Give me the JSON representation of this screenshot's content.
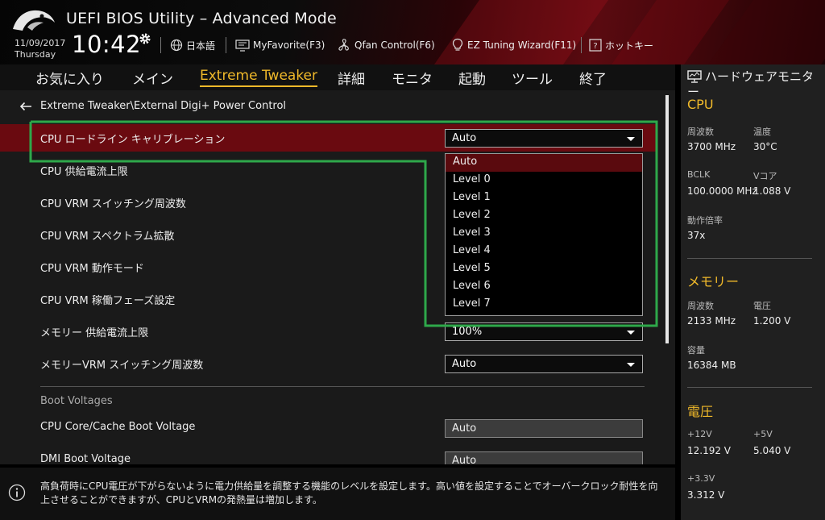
{
  "header": {
    "title": "UEFI BIOS Utility – Advanced Mode",
    "date": "11/09/2017",
    "day": "Thursday",
    "time": "10:42",
    "items": [
      {
        "label": "日本語",
        "icon": "globe-icon"
      },
      {
        "label": "MyFavorite(F3)",
        "icon": "favorite-monitor-icon"
      },
      {
        "label": "Qfan Control(F6)",
        "icon": "fan-icon"
      },
      {
        "label": "EZ Tuning Wizard(F11)",
        "icon": "bulb-icon"
      },
      {
        "label": "ホットキー",
        "icon": "hotkey-icon"
      }
    ]
  },
  "tabs": [
    {
      "label": "お気に入り",
      "active": false
    },
    {
      "label": "メイン",
      "active": false
    },
    {
      "label": "Extreme Tweaker",
      "active": true
    },
    {
      "label": "詳細",
      "active": false
    },
    {
      "label": "モニタ",
      "active": false
    },
    {
      "label": "起動",
      "active": false
    },
    {
      "label": "ツール",
      "active": false
    },
    {
      "label": "終了",
      "active": false
    }
  ],
  "breadcrumb": "Extreme Tweaker\\External Digi+ Power Control",
  "settings": [
    {
      "label": "CPU ロードライン キャリブレーション",
      "value": "Auto"
    },
    {
      "label": "CPU 供給電流上限",
      "value": ""
    },
    {
      "label": "CPU VRM スイッチング周波数",
      "value": ""
    },
    {
      "label": "CPU VRM スペクトラム拡散",
      "value": ""
    },
    {
      "label": "CPU VRM 動作モード",
      "value": ""
    },
    {
      "label": "CPU VRM 稼働フェーズ設定",
      "value": ""
    },
    {
      "label": "メモリー 供給電流上限",
      "value": "100%"
    },
    {
      "label": "メモリーVRM スイッチング周波数",
      "value": "Auto"
    }
  ],
  "boot_section": {
    "title": "Boot Voltages",
    "items": [
      {
        "label": "CPU Core/Cache Boot Voltage",
        "value": "Auto"
      },
      {
        "label": "DMI Boot Voltage",
        "value": "Auto"
      }
    ]
  },
  "dropdown": {
    "options": [
      "Auto",
      "Level 0",
      "Level 1",
      "Level 2",
      "Level 3",
      "Level 4",
      "Level 5",
      "Level 6",
      "Level 7"
    ],
    "highlighted": "Auto"
  },
  "help_text": "高負荷時にCPU電圧が下がらないように電力供給量を調整する機能のレベルを設定します。高い値を設定することでオーバークロック耐性を向上させることができますが、CPUとVRMの発熱量は増加します。",
  "hw_monitor": {
    "title": "ハードウェアモニター",
    "cpu": {
      "title": "CPU",
      "freq_label": "周波数",
      "freq": "3700 MHz",
      "temp_label": "温度",
      "temp": "30°C",
      "bclk_label": "BCLK",
      "bclk": "100.0000 MHz",
      "vcore_label": "Vコア",
      "vcore": "1.088 V",
      "ratio_label": "動作倍率",
      "ratio": "37x"
    },
    "memory": {
      "title": "メモリー",
      "freq_label": "周波数",
      "freq": "2133 MHz",
      "volt_label": "電圧",
      "volt": "1.200 V",
      "cap_label": "容量",
      "cap": "16384 MB"
    },
    "voltage": {
      "title": "電圧",
      "v12_label": "+12V",
      "v12": "12.192 V",
      "v5_label": "+5V",
      "v5": "5.040 V",
      "v33_label": "+3.3V",
      "v33": "3.312 V"
    }
  },
  "colors": {
    "accent": "#f0b92a",
    "selected_row": "#6a0a10",
    "annotation": "#2ea84a"
  }
}
